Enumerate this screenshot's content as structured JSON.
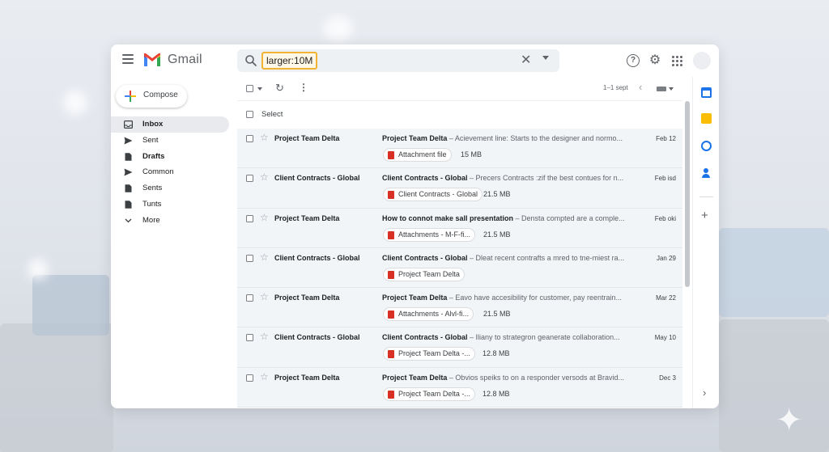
{
  "app": {
    "name": "Gmail"
  },
  "search": {
    "query": "larger:10M"
  },
  "icons": {
    "menu": "hamburger-menu-icon",
    "search": "search-icon",
    "clear": "close-icon",
    "help": "help-circle-icon",
    "settings": "gear-icon",
    "apps": "apps-grid-icon"
  },
  "compose": {
    "label": "Compose"
  },
  "nav": {
    "items": [
      {
        "label": "Inbox",
        "icon": "inbox-icon",
        "active": true
      },
      {
        "label": "Sent",
        "icon": "send-icon"
      },
      {
        "label": "Drafts",
        "icon": "draft-icon"
      },
      {
        "label": "Common",
        "icon": "send-icon"
      },
      {
        "label": "Sents",
        "icon": "document-icon"
      },
      {
        "label": "Tunts",
        "icon": "document-icon"
      },
      {
        "label": "More",
        "icon": "chevron-down-icon"
      }
    ]
  },
  "toolbar": {
    "pagination": "1–1 sept",
    "select_label": "Select"
  },
  "emails": [
    {
      "sender": "Project Team Delta",
      "subject": "Project Team Delta",
      "snippet": "Acievement line: Starts to the designer and normo...",
      "date": "Feb 12",
      "attachment": "Attachment file",
      "size": "15 MB"
    },
    {
      "sender": "Client Contracts - Global",
      "subject": "Client Contracts - Global",
      "snippet": "Precers Contracts :zif the best contues for n...",
      "date": "Feb isd",
      "attachment": "Client Contracts - Global",
      "size": "21.5 MB"
    },
    {
      "sender": "Project Team Delta",
      "subject": "How to connot make sall presentation",
      "snippet": "Densta compted are a comple...",
      "date": "Feb oki",
      "attachment": "Attachments - M-F-fi...",
      "size": "21.5 MB"
    },
    {
      "sender": "Client Contracts - Global",
      "subject": "Client Contracts - Global",
      "snippet": "Dleat recent contrafts a mred to tne-miest ra...",
      "date": "Jan 29",
      "attachment": "Project Team Delta",
      "size": ""
    },
    {
      "sender": "Project Team Delta",
      "subject": "Project Team Delta",
      "snippet": "Eavo have accesibility for customer, pay reentrain...",
      "date": "Mar 22",
      "attachment": "Attachments - Alvl-fi...",
      "size": "21.5 MB"
    },
    {
      "sender": "Client Contracts - Global",
      "subject": "Client Contracts - Global",
      "snippet": "Iliany to strategron geanerate collaboration...",
      "date": "May 10",
      "attachment": "Project Team Delta -...",
      "size": "12.8 MB"
    },
    {
      "sender": "Project Team Delta",
      "subject": "Project Team Delta",
      "snippet": "Obvios speiks to on a responder versods at Bravid...",
      "date": "Dec 3",
      "attachment": "Project Team Delta -...",
      "size": "12.8 MB"
    }
  ],
  "side_panel": {
    "apps": [
      "calendar-icon",
      "keep-icon",
      "tasks-icon",
      "contacts-icon",
      "add-icon",
      "chevron-right-icon"
    ]
  },
  "colors": {
    "accent_blue": "#1a73e8",
    "search_highlight": "#f2b233",
    "attachment_pdf": "#d93025",
    "row_background": "#f2f5f8"
  }
}
